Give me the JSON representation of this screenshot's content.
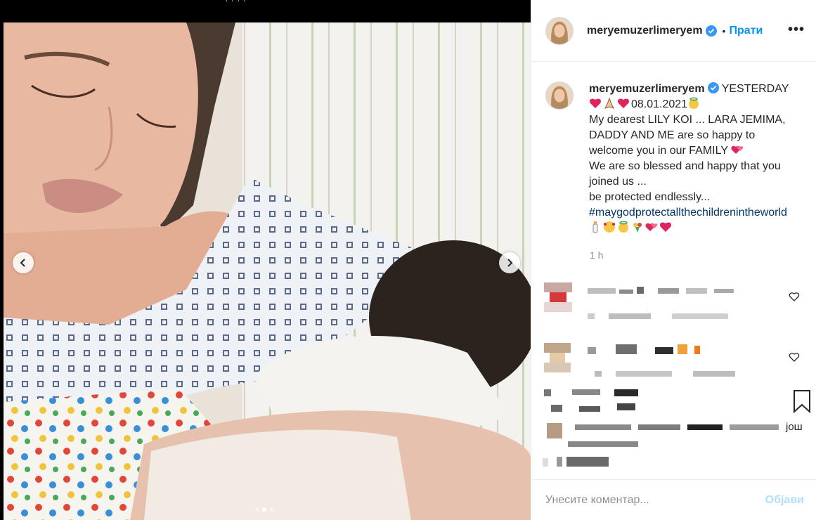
{
  "media": {
    "top_text": "· · · ·",
    "prev_icon": "chevron-left-icon",
    "next_icon": "chevron-right-icon",
    "carousel_count": 3,
    "carousel_active_index": 1
  },
  "header": {
    "username": "meryemuzerlimeryem",
    "separator": "•",
    "follow_label": "Прати",
    "more_label": "•••"
  },
  "caption": {
    "username": "meryemuzerlimeryem",
    "first_line": "YESTERDAY",
    "date": "08.01.2021",
    "line1": "My dearest LILY KOI ... LARA JEMIMA, DADDY AND ME are so happy to welcome you in our FAMILY",
    "line2": "We are so blessed and happy that you joined us ...",
    "line3": "be protected endlessly...",
    "hashtag": "#maygodprotectallthechildrenintheworld",
    "time_ago": "1 h"
  },
  "comments": {
    "more_label": "још"
  },
  "comment_bar": {
    "placeholder": "Унесите коментар...",
    "post_label": "Објави"
  },
  "colors": {
    "accent": "#0095f6",
    "verified": "#3897f0",
    "hashtag": "#00376b",
    "post_disabled": "#b2dffc",
    "heart": "#e0245e"
  }
}
